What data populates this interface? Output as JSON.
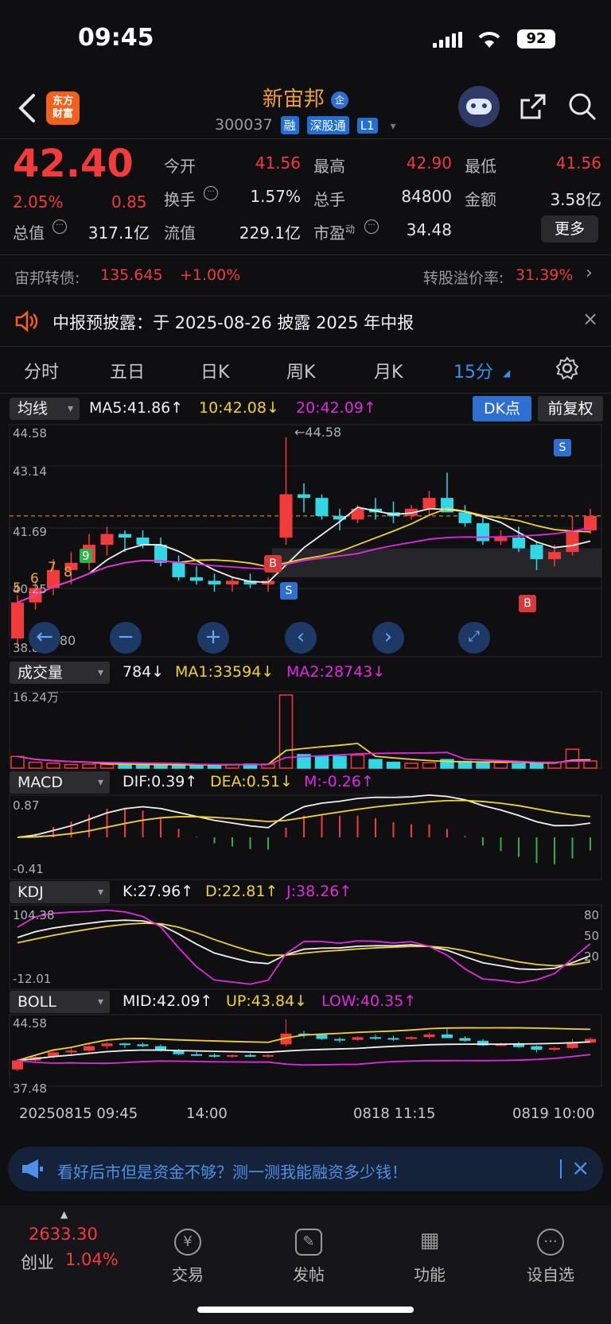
{
  "status": {
    "time": "09:45",
    "battery": "92"
  },
  "header": {
    "logo": [
      "东方",
      "财富"
    ],
    "stock_name": "新宙邦",
    "stock_tag": "企",
    "stock_code": "300037",
    "badges": [
      "融",
      "深股通",
      "L1"
    ]
  },
  "quote": {
    "price": "42.40",
    "change_pct": "2.05%",
    "change": "0.85",
    "open_label": "今开",
    "open": "41.56",
    "high_label": "最高",
    "high": "42.90",
    "low_label": "最低",
    "low": "41.56",
    "turnover_label": "换手",
    "turnover": "1.57%",
    "volume_label": "总手",
    "volume": "84800",
    "amount_label": "金额",
    "amount": "3.58亿",
    "mktcap_label": "总值",
    "mktcap": "317.1亿",
    "float_label": "流值",
    "float": "229.1亿",
    "pe_label": "市盈",
    "pe_sup": "动",
    "pe": "34.48",
    "more": "更多"
  },
  "bond": {
    "label": "宙邦转债:",
    "price": "135.645",
    "change": "+1.00%",
    "premium_label": "转股溢价率:",
    "premium": "31.39%"
  },
  "notice": {
    "text": "中报预披露：于 2025-08-26 披露 2025 年中报"
  },
  "tabs": [
    "分时",
    "五日",
    "日K",
    "周K",
    "月K",
    "15分"
  ],
  "ma_row": {
    "selector": "均线",
    "ma5": "MA5:41.86↑",
    "ma10": "10:42.08↓",
    "ma20": "20:42.09↑",
    "dk": "DK点",
    "adj": "前复权"
  },
  "kline_axis": {
    "top": "44.58",
    "mid1": "43.14",
    "mid2": "41.69",
    "low2": "40.25",
    "bottom": "38.80",
    "max_note": "44.58",
    "min_note": "38.80"
  },
  "markers": {
    "buy": "B",
    "sell": "S",
    "n5": "5",
    "n6": "6",
    "n7": "7",
    "n8": "8",
    "n9": "9"
  },
  "vol_row": {
    "selector": "成交量",
    "v": "784↓",
    "ma1": "MA1:33594↓",
    "ma2": "MA2:28743↓",
    "axis_top": "16.24万"
  },
  "macd_row": {
    "selector": "MACD",
    "dif": "DIF:0.39↑",
    "dea": "DEA:0.51↓",
    "m": "M:-0.26↑",
    "axis_top": "0.87",
    "axis_bottom": "-0.41"
  },
  "kdj_row": {
    "selector": "KDJ",
    "k": "K:27.96↑",
    "d": "D:22.81↑",
    "j": "J:38.26↑",
    "axis_top": "104.38",
    "axis_bottom": "-12.01",
    "r80": "80",
    "r50": "50",
    "r20": "20"
  },
  "boll_row": {
    "selector": "BOLL",
    "mid": "MID:42.09↑",
    "up": "UP:43.84↓",
    "low": "LOW:40.35↑",
    "axis_top": "44.58",
    "axis_bottom": "37.48"
  },
  "time_axis": [
    "20250815 09:45",
    "14:00",
    "0818 11:15",
    "0819 10:00"
  ],
  "promo": {
    "text": "看好后市但是资金不够？测一测我能融资多少钱！"
  },
  "nav": {
    "index_value": "2633.30",
    "index_name": "创业",
    "index_change": "1.04%",
    "items": [
      "交易",
      "发帖",
      "功能",
      "设自选"
    ]
  },
  "colors": {
    "up": "#f23b3b",
    "down": "#2fd8e4",
    "accent": "#3a8ff0",
    "ma5": "#f0f0f0",
    "ma10": "#f2d32a",
    "ma20": "#e02ae0"
  },
  "chart_data": {
    "type": "candlestick",
    "candles": [
      [
        39.0,
        40.2,
        38.8,
        40.0
      ],
      [
        40.0,
        40.6,
        39.8,
        40.4
      ],
      [
        40.4,
        41.2,
        40.2,
        40.9
      ],
      [
        40.9,
        41.4,
        40.5,
        41.1
      ],
      [
        41.1,
        41.9,
        40.9,
        41.6
      ],
      [
        41.6,
        42.1,
        41.3,
        41.9
      ],
      [
        41.9,
        42.0,
        41.4,
        41.8
      ],
      [
        41.8,
        42.0,
        41.5,
        41.6
      ],
      [
        41.6,
        41.8,
        41.0,
        41.1
      ],
      [
        41.1,
        41.3,
        40.6,
        40.7
      ],
      [
        40.7,
        41.0,
        40.5,
        40.6
      ],
      [
        40.6,
        40.8,
        40.3,
        40.5
      ],
      [
        40.5,
        40.7,
        40.3,
        40.6
      ],
      [
        40.6,
        40.8,
        40.4,
        40.5
      ],
      [
        40.5,
        40.7,
        40.3,
        40.6
      ],
      [
        41.8,
        44.58,
        41.6,
        43.0
      ],
      [
        43.0,
        43.3,
        42.5,
        42.9
      ],
      [
        42.9,
        43.0,
        42.3,
        42.4
      ],
      [
        42.4,
        42.6,
        42.0,
        42.3
      ],
      [
        42.3,
        42.7,
        42.2,
        42.6
      ],
      [
        42.6,
        42.9,
        42.3,
        42.5
      ],
      [
        42.5,
        42.8,
        42.2,
        42.4
      ],
      [
        42.4,
        42.7,
        42.3,
        42.6
      ],
      [
        42.6,
        43.1,
        42.4,
        42.9
      ],
      [
        42.9,
        43.6,
        42.5,
        42.5
      ],
      [
        42.5,
        42.7,
        42.1,
        42.2
      ],
      [
        42.2,
        42.4,
        41.6,
        41.7
      ],
      [
        41.7,
        42.0,
        41.6,
        41.8
      ],
      [
        41.8,
        42.1,
        41.4,
        41.5
      ],
      [
        41.6,
        41.7,
        40.9,
        41.2
      ],
      [
        41.2,
        41.6,
        41.0,
        41.4
      ],
      [
        41.4,
        42.4,
        41.3,
        42.0
      ],
      [
        42.0,
        42.6,
        41.9,
        42.4
      ]
    ],
    "volumes": [
      2.6,
      1.3,
      1.1,
      0.8,
      0.9,
      0.8,
      0.9,
      0.7,
      0.7,
      0.7,
      0.8,
      0.8,
      0.8,
      0.9,
      0.9,
      16.24,
      3.0,
      2.7,
      2.6,
      2.9,
      1.9,
      1.3,
      1.1,
      1.2,
      1.9,
      1.5,
      1.1,
      1.2,
      1.0,
      1.1,
      1.3,
      4.2,
      1.6
    ],
    "ylim": [
      38.8,
      44.58
    ]
  }
}
